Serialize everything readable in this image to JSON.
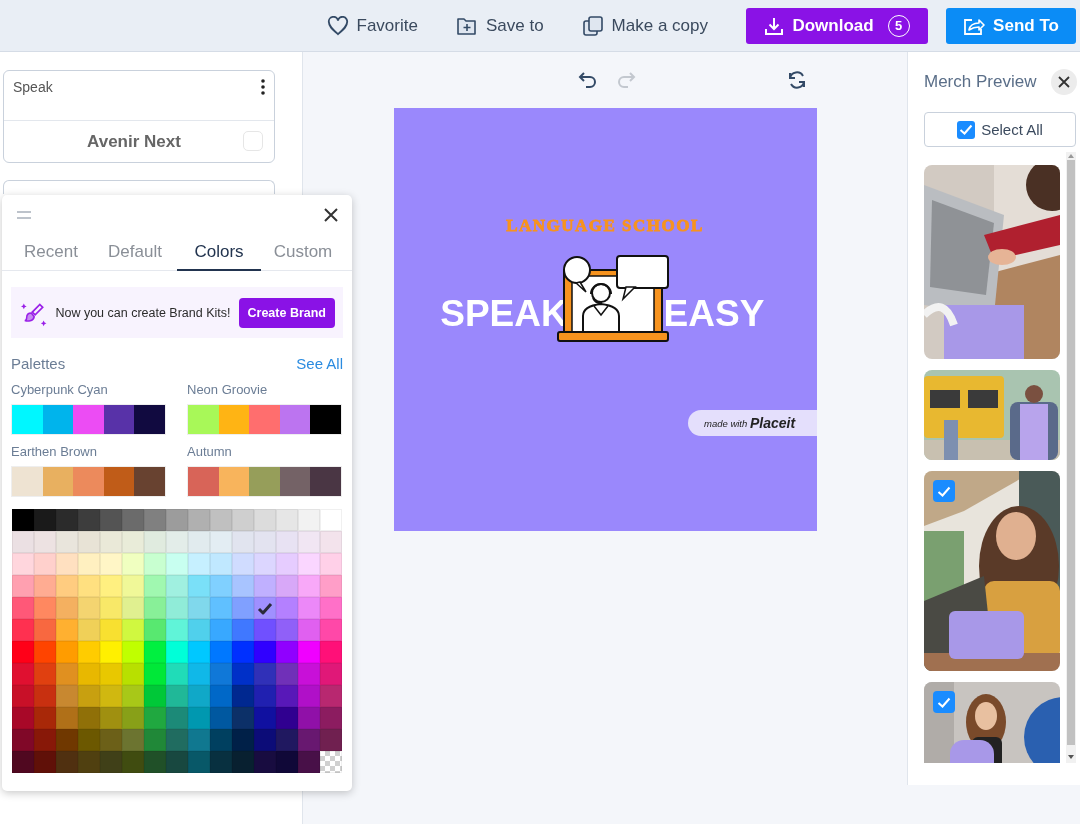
{
  "toolbar": {
    "actions": [
      {
        "label": "Favorite",
        "kind": "favorite"
      },
      {
        "label": "Save to",
        "kind": "save"
      },
      {
        "label": "Make a copy",
        "kind": "copy"
      },
      {
        "label": "Download",
        "kind": "download",
        "badge": "5"
      },
      {
        "label": "Send To",
        "kind": "send"
      }
    ]
  },
  "layers": [
    {
      "text": "Speak",
      "font": "Avenir Next"
    }
  ],
  "color_popup": {
    "tabs": [
      {
        "label": "Recent",
        "selected": false
      },
      {
        "label": "Default",
        "selected": false
      },
      {
        "label": "Colors",
        "selected": true
      },
      {
        "label": "Custom",
        "selected": false
      }
    ],
    "banner": {
      "text": "Now you can create Brand Kits!",
      "button": "Create Brand"
    },
    "palettes_heading": "Palettes",
    "see_all": "See All",
    "palettes": [
      {
        "name": "Cyberpunk Cyan",
        "colors": [
          {
            "color": "#00f7ff"
          },
          {
            "color": "#00b4ec"
          },
          {
            "color": "#ec4cf4"
          },
          {
            "color": "#5832a8"
          },
          {
            "color": "#110a40"
          }
        ]
      },
      {
        "name": "Neon Groovie",
        "colors": [
          {
            "color": "#a8f858"
          },
          {
            "color": "#ffb414"
          },
          {
            "color": "#ff6e6e"
          },
          {
            "color": "#bc74f0"
          },
          {
            "color": "#000000"
          }
        ]
      },
      {
        "name": "Earthen Brown",
        "colors": [
          {
            "color": "#eee3d2"
          },
          {
            "color": "#e8b060"
          },
          {
            "color": "#ec8a5c"
          },
          {
            "color": "#c05c18"
          },
          {
            "color": "#684230"
          }
        ]
      },
      {
        "name": "Autumn",
        "colors": [
          {
            "color": "#d86458"
          },
          {
            "color": "#f8b45c"
          },
          {
            "color": "#969e5a"
          },
          {
            "color": "#746266"
          },
          {
            "color": "#4a3644"
          }
        ]
      }
    ],
    "swatch_rows": [
      [
        {
          "kind": "color",
          "color": "#000000",
          "selected": false
        },
        {
          "kind": "color",
          "color": "#1a1a1a",
          "selected": false
        },
        {
          "kind": "color",
          "color": "#2b2b2b",
          "selected": false
        },
        {
          "kind": "color",
          "color": "#3d3d3d",
          "selected": false
        },
        {
          "kind": "color",
          "color": "#545454",
          "selected": false
        },
        {
          "kind": "color",
          "color": "#6b6b6b",
          "selected": false
        },
        {
          "kind": "color",
          "color": "#808080",
          "selected": false
        },
        {
          "kind": "color",
          "color": "#9c9c9c",
          "selected": false
        },
        {
          "kind": "color",
          "color": "#b0b0b0",
          "selected": false
        },
        {
          "kind": "color",
          "color": "#c0c0c0",
          "selected": false
        },
        {
          "kind": "color",
          "color": "#cfcfcf",
          "selected": false
        },
        {
          "kind": "color",
          "color": "#dcdcdc",
          "selected": false
        },
        {
          "kind": "color",
          "color": "#e6e6e6",
          "selected": false
        },
        {
          "kind": "color",
          "color": "#f2f2f2",
          "selected": false
        },
        {
          "kind": "color",
          "color": "#ffffff",
          "selected": false
        }
      ],
      [
        {
          "kind": "color",
          "color": "#ebe0e3",
          "selected": false
        },
        {
          "kind": "color",
          "color": "#ede2e2",
          "selected": false
        },
        {
          "kind": "color",
          "color": "#e9e5dc",
          "selected": false
        },
        {
          "kind": "color",
          "color": "#e8e3d6",
          "selected": false
        },
        {
          "kind": "color",
          "color": "#eae9d8",
          "selected": false
        },
        {
          "kind": "color",
          "color": "#e9ecd9",
          "selected": false
        },
        {
          "kind": "color",
          "color": "#e0ebdf",
          "selected": false
        },
        {
          "kind": "color",
          "color": "#e3ede9",
          "selected": false
        },
        {
          "kind": "color",
          "color": "#e1ebee",
          "selected": false
        },
        {
          "kind": "color",
          "color": "#e3edf3",
          "selected": false
        },
        {
          "kind": "color",
          "color": "#e1e4ef",
          "selected": false
        },
        {
          "kind": "color",
          "color": "#e3e3f0",
          "selected": false
        },
        {
          "kind": "color",
          "color": "#e8e2f3",
          "selected": false
        },
        {
          "kind": "color",
          "color": "#f1e6f3",
          "selected": false
        },
        {
          "kind": "color",
          "color": "#f3e3ec",
          "selected": false
        }
      ],
      [
        {
          "kind": "color",
          "color": "#ffd6dd",
          "selected": false
        },
        {
          "kind": "color",
          "color": "#ffd0cc",
          "selected": false
        },
        {
          "kind": "color",
          "color": "#ffe0c0",
          "selected": false
        },
        {
          "kind": "color",
          "color": "#fff0c0",
          "selected": false
        },
        {
          "kind": "color",
          "color": "#fff6c6",
          "selected": false
        },
        {
          "kind": "color",
          "color": "#f0ffc0",
          "selected": false
        },
        {
          "kind": "color",
          "color": "#c8ffd0",
          "selected": false
        },
        {
          "kind": "color",
          "color": "#c8fff0",
          "selected": false
        },
        {
          "kind": "color",
          "color": "#c6f0ff",
          "selected": false
        },
        {
          "kind": "color",
          "color": "#c0e8ff",
          "selected": false
        },
        {
          "kind": "color",
          "color": "#d0dcff",
          "selected": false
        },
        {
          "kind": "color",
          "color": "#dcd6ff",
          "selected": false
        },
        {
          "kind": "color",
          "color": "#e6ccff",
          "selected": false
        },
        {
          "kind": "color",
          "color": "#fad6ff",
          "selected": false
        },
        {
          "kind": "color",
          "color": "#ffd0e8",
          "selected": false
        }
      ],
      [
        {
          "kind": "color",
          "color": "#ffa0b0",
          "selected": false
        },
        {
          "kind": "color",
          "color": "#ffac92",
          "selected": false
        },
        {
          "kind": "color",
          "color": "#ffcc80",
          "selected": false
        },
        {
          "kind": "color",
          "color": "#ffe080",
          "selected": false
        },
        {
          "kind": "color",
          "color": "#fff080",
          "selected": false
        },
        {
          "kind": "color",
          "color": "#f0f898",
          "selected": false
        },
        {
          "kind": "color",
          "color": "#a0f8b0",
          "selected": false
        },
        {
          "kind": "color",
          "color": "#a0f0e0",
          "selected": false
        },
        {
          "kind": "color",
          "color": "#7ae0f8",
          "selected": false
        },
        {
          "kind": "color",
          "color": "#80d0ff",
          "selected": false
        },
        {
          "kind": "color",
          "color": "#a8c4ff",
          "selected": false
        },
        {
          "kind": "color",
          "color": "#c0b0ff",
          "selected": false
        },
        {
          "kind": "color",
          "color": "#d8a8f8",
          "selected": false
        },
        {
          "kind": "color",
          "color": "#f8a8f8",
          "selected": false
        },
        {
          "kind": "color",
          "color": "#ff9ec8",
          "selected": false
        }
      ],
      [
        {
          "kind": "color",
          "color": "#ff5878",
          "selected": false
        },
        {
          "kind": "color",
          "color": "#ff8860",
          "selected": false
        },
        {
          "kind": "color",
          "color": "#f4b060",
          "selected": false
        },
        {
          "kind": "color",
          "color": "#f4d470",
          "selected": false
        },
        {
          "kind": "color",
          "color": "#f8e868",
          "selected": false
        },
        {
          "kind": "color",
          "color": "#e0f090",
          "selected": false
        },
        {
          "kind": "color",
          "color": "#88f098",
          "selected": false
        },
        {
          "kind": "color",
          "color": "#90ecd8",
          "selected": false
        },
        {
          "kind": "color",
          "color": "#80d8ec",
          "selected": false
        },
        {
          "kind": "color",
          "color": "#60c0ff",
          "selected": false
        },
        {
          "kind": "color",
          "color": "#80a0ff",
          "selected": false
        },
        {
          "kind": "color",
          "color": "#a090ff",
          "selected": true
        },
        {
          "kind": "color",
          "color": "#b480ff",
          "selected": false
        },
        {
          "kind": "color",
          "color": "#ec88f8",
          "selected": false
        },
        {
          "kind": "color",
          "color": "#ff70c8",
          "selected": false
        }
      ],
      [
        {
          "kind": "color",
          "color": "#ff3050",
          "selected": false
        },
        {
          "kind": "color",
          "color": "#f86840",
          "selected": false
        },
        {
          "kind": "color",
          "color": "#ffb030",
          "selected": false
        },
        {
          "kind": "color",
          "color": "#f0d058",
          "selected": false
        },
        {
          "kind": "color",
          "color": "#f8e030",
          "selected": false
        },
        {
          "kind": "color",
          "color": "#d0f840",
          "selected": false
        },
        {
          "kind": "color",
          "color": "#58e870",
          "selected": false
        },
        {
          "kind": "color",
          "color": "#60f4d8",
          "selected": false
        },
        {
          "kind": "color",
          "color": "#50d0ec",
          "selected": false
        },
        {
          "kind": "color",
          "color": "#38a8ff",
          "selected": false
        },
        {
          "kind": "color",
          "color": "#4078ff",
          "selected": false
        },
        {
          "kind": "color",
          "color": "#7050ff",
          "selected": false
        },
        {
          "kind": "color",
          "color": "#9060f8",
          "selected": false
        },
        {
          "kind": "color",
          "color": "#e060f0",
          "selected": false
        },
        {
          "kind": "color",
          "color": "#ff48a8",
          "selected": false
        }
      ],
      [
        {
          "kind": "color",
          "color": "#ff0018",
          "selected": false
        },
        {
          "kind": "color",
          "color": "#ff4400",
          "selected": false
        },
        {
          "kind": "color",
          "color": "#ff9c00",
          "selected": false
        },
        {
          "kind": "color",
          "color": "#ffcc00",
          "selected": false
        },
        {
          "kind": "color",
          "color": "#fff000",
          "selected": false
        },
        {
          "kind": "color",
          "color": "#c0ff00",
          "selected": false
        },
        {
          "kind": "color",
          "color": "#00f040",
          "selected": false
        },
        {
          "kind": "color",
          "color": "#00ffd8",
          "selected": false
        },
        {
          "kind": "color",
          "color": "#00c8ff",
          "selected": false
        },
        {
          "kind": "color",
          "color": "#0078ff",
          "selected": false
        },
        {
          "kind": "color",
          "color": "#0030ff",
          "selected": false
        },
        {
          "kind": "color",
          "color": "#3000ff",
          "selected": false
        },
        {
          "kind": "color",
          "color": "#9000ff",
          "selected": false
        },
        {
          "kind": "color",
          "color": "#f000ff",
          "selected": false
        },
        {
          "kind": "color",
          "color": "#ff1078",
          "selected": false
        }
      ],
      [
        {
          "kind": "color",
          "color": "#e01030",
          "selected": false
        },
        {
          "kind": "color",
          "color": "#e04010",
          "selected": false
        },
        {
          "kind": "color",
          "color": "#e09020",
          "selected": false
        },
        {
          "kind": "color",
          "color": "#e8b800",
          "selected": false
        },
        {
          "kind": "color",
          "color": "#e8c800",
          "selected": false
        },
        {
          "kind": "color",
          "color": "#b8e000",
          "selected": false
        },
        {
          "kind": "color",
          "color": "#00e838",
          "selected": false
        },
        {
          "kind": "color",
          "color": "#20dcb8",
          "selected": false
        },
        {
          "kind": "color",
          "color": "#10b8e8",
          "selected": false
        },
        {
          "kind": "color",
          "color": "#1078d8",
          "selected": false
        },
        {
          "kind": "color",
          "color": "#0030c8",
          "selected": false
        },
        {
          "kind": "color",
          "color": "#3030b8",
          "selected": false
        },
        {
          "kind": "color",
          "color": "#7030b8",
          "selected": false
        },
        {
          "kind": "color",
          "color": "#c810d8",
          "selected": false
        },
        {
          "kind": "color",
          "color": "#e01878",
          "selected": false
        }
      ],
      [
        {
          "kind": "color",
          "color": "#c81028",
          "selected": false
        },
        {
          "kind": "color",
          "color": "#c83010",
          "selected": false
        },
        {
          "kind": "color",
          "color": "#c88830",
          "selected": false
        },
        {
          "kind": "color",
          "color": "#c8a010",
          "selected": false
        },
        {
          "kind": "color",
          "color": "#d0b810",
          "selected": false
        },
        {
          "kind": "color",
          "color": "#a8c818",
          "selected": false
        },
        {
          "kind": "color",
          "color": "#00c838",
          "selected": false
        },
        {
          "kind": "color",
          "color": "#20b898",
          "selected": false
        },
        {
          "kind": "color",
          "color": "#10a8c8",
          "selected": false
        },
        {
          "kind": "color",
          "color": "#0068c8",
          "selected": false
        },
        {
          "kind": "color",
          "color": "#002890",
          "selected": false
        },
        {
          "kind": "color",
          "color": "#2020b0",
          "selected": false
        },
        {
          "kind": "color",
          "color": "#5818b8",
          "selected": false
        },
        {
          "kind": "color",
          "color": "#b010c8",
          "selected": false
        },
        {
          "kind": "color",
          "color": "#b82870",
          "selected": false
        }
      ],
      [
        {
          "kind": "color",
          "color": "#a80828",
          "selected": false
        },
        {
          "kind": "color",
          "color": "#a82808",
          "selected": false
        },
        {
          "kind": "color",
          "color": "#b07018",
          "selected": false
        },
        {
          "kind": "color",
          "color": "#907008",
          "selected": false
        },
        {
          "kind": "color",
          "color": "#a09010",
          "selected": false
        },
        {
          "kind": "color",
          "color": "#88a018",
          "selected": false
        },
        {
          "kind": "color",
          "color": "#20a840",
          "selected": false
        },
        {
          "kind": "color",
          "color": "#1c8a78",
          "selected": false
        },
        {
          "kind": "color",
          "color": "#0098b0",
          "selected": false
        },
        {
          "kind": "color",
          "color": "#0058a0",
          "selected": false
        },
        {
          "kind": "color",
          "color": "#0c3068",
          "selected": false
        },
        {
          "kind": "color",
          "color": "#1010a0",
          "selected": false
        },
        {
          "kind": "color",
          "color": "#300090",
          "selected": false
        },
        {
          "kind": "color",
          "color": "#9010a8",
          "selected": false
        },
        {
          "kind": "color",
          "color": "#8c1c60",
          "selected": false
        }
      ],
      [
        {
          "kind": "color",
          "color": "#800828",
          "selected": false
        },
        {
          "kind": "color",
          "color": "#881808",
          "selected": false
        },
        {
          "kind": "color",
          "color": "#703800",
          "selected": false
        },
        {
          "kind": "color",
          "color": "#6c5800",
          "selected": false
        },
        {
          "kind": "color",
          "color": "#6c6018",
          "selected": false
        },
        {
          "kind": "color",
          "color": "#6c7430",
          "selected": false
        },
        {
          "kind": "color",
          "color": "#208838",
          "selected": false
        },
        {
          "kind": "color",
          "color": "#206c60",
          "selected": false
        },
        {
          "kind": "color",
          "color": "#107890",
          "selected": false
        },
        {
          "kind": "color",
          "color": "#004060",
          "selected": false
        },
        {
          "kind": "color",
          "color": "#002048",
          "selected": false
        },
        {
          "kind": "color",
          "color": "#0c0c78",
          "selected": false
        },
        {
          "kind": "color",
          "color": "#201860",
          "selected": false
        },
        {
          "kind": "color",
          "color": "#681870",
          "selected": false
        },
        {
          "kind": "color",
          "color": "#702050",
          "selected": false
        }
      ],
      [
        {
          "kind": "color",
          "color": "#500820",
          "selected": false
        },
        {
          "kind": "color",
          "color": "#601008",
          "selected": false
        },
        {
          "kind": "color",
          "color": "#503010",
          "selected": false
        },
        {
          "kind": "color",
          "color": "#504010",
          "selected": false
        },
        {
          "kind": "color",
          "color": "#404018",
          "selected": false
        },
        {
          "kind": "color",
          "color": "#404c10",
          "selected": false
        },
        {
          "kind": "color",
          "color": "#205028",
          "selected": false
        },
        {
          "kind": "color",
          "color": "#184840",
          "selected": false
        },
        {
          "kind": "color",
          "color": "#085868",
          "selected": false
        },
        {
          "kind": "color",
          "color": "#083040",
          "selected": false
        },
        {
          "kind": "color",
          "color": "#082030",
          "selected": false
        },
        {
          "kind": "color",
          "color": "#180c40",
          "selected": false
        },
        {
          "kind": "color",
          "color": "#100838",
          "selected": false
        },
        {
          "kind": "color",
          "color": "#481048",
          "selected": false
        },
        {
          "kind": "transparent",
          "selected": false
        }
      ]
    ]
  },
  "canvas": {
    "tools": [
      {
        "kind": "undo",
        "disabled": false
      },
      {
        "kind": "redo",
        "disabled": true
      },
      {
        "kind": "refresh",
        "disabled": false
      }
    ],
    "design": {
      "subtitle": "LANGUAGE SCHOOL",
      "word_left": "SPEAK",
      "word_right": "EASY",
      "badge_prefix": "made with",
      "badge_brand": "Placeit"
    }
  },
  "merch": {
    "title": "Merch Preview",
    "select_all": {
      "label": "Select All",
      "checked": true
    },
    "items": [
      {
        "kind": "picture",
        "selected": false
      },
      {
        "kind": "picture",
        "selected": false
      },
      {
        "kind": "picture",
        "selected": true
      },
      {
        "kind": "picture",
        "selected": true
      }
    ]
  }
}
